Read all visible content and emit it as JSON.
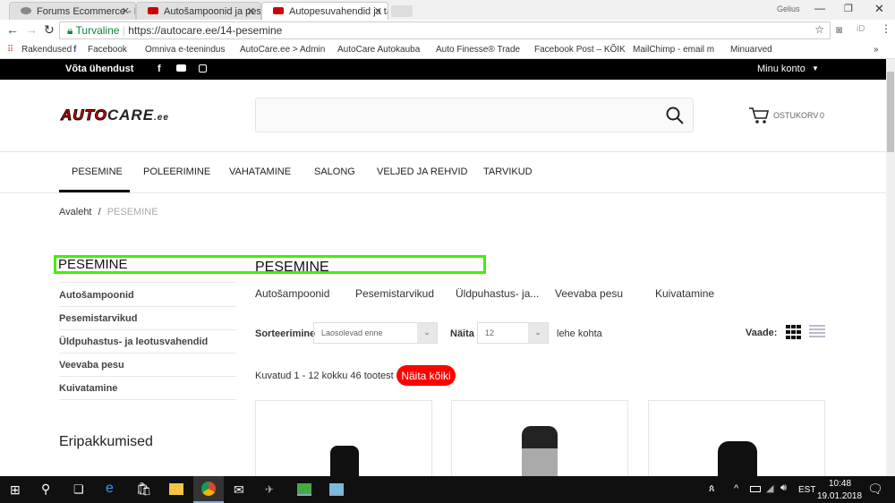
{
  "browser": {
    "tabs": [
      {
        "label": "Forums Ecommerce - Pre"
      },
      {
        "label": "Autošampoonid ja pesuv"
      },
      {
        "label": "Autopesuvahendid ja tar"
      }
    ],
    "profile": "Gelius",
    "secure_label": "Turvaline",
    "url": "https://autocare.ee/14-pesemine",
    "bookmarks": [
      "Rakendused",
      "Facebook",
      "Omniva e-teenindus",
      "AutoCare.ee > Admin",
      "AutoCare Autokauba",
      "Auto Finesse® Trade",
      "Facebook Post – KÕIK",
      "MailChimp - email m",
      "Minuarved"
    ],
    "more": "»"
  },
  "topbar": {
    "contact": "Võta ühendust",
    "account": "Minu konto"
  },
  "header": {
    "logo": "AUTOCARE.ee",
    "cart_label": "OSTUKORV",
    "cart_count": "0",
    "search_placeholder": ""
  },
  "nav": [
    "PESEMINE",
    "POLEERIMINE",
    "VAHATAMINE",
    "SALONG",
    "VELJED JA REHVID",
    "TARVIKUD"
  ],
  "breadcrumb": {
    "home": "Avaleht",
    "sep": "/",
    "current": "PESEMINE"
  },
  "sidebar": {
    "title": "PESEMINE",
    "items": [
      "Autošampoonid",
      "Pesemistarvikud",
      "Üldpuhastus- ja leotusvahendid",
      "Veevaba pesu",
      "Kuivatamine"
    ],
    "specials": "Eripakkumised"
  },
  "main": {
    "title": "PESEMINE",
    "subcategories": [
      "Autošampoonid",
      "Pesemistarvikud",
      "Üldpuhastus- ja...",
      "Veevaba pesu",
      "Kuivatamine"
    ],
    "sort_label": "Sorteerimine",
    "sort_value": "Laosolevad enne",
    "show_label": "Näita",
    "show_value": "12",
    "per_page": "lehe kohta",
    "view_label": "Vaade:",
    "count_text": "Kuvatud 1 - 12 kokku 46 tootest",
    "show_all": "Näita kõiki"
  },
  "taskbar": {
    "lang": "EST",
    "time": "10:48",
    "date": "19.01.2018"
  },
  "colors": {
    "accent": "#ff0000",
    "highlight": "#44ee00",
    "topbar": "#000000"
  }
}
